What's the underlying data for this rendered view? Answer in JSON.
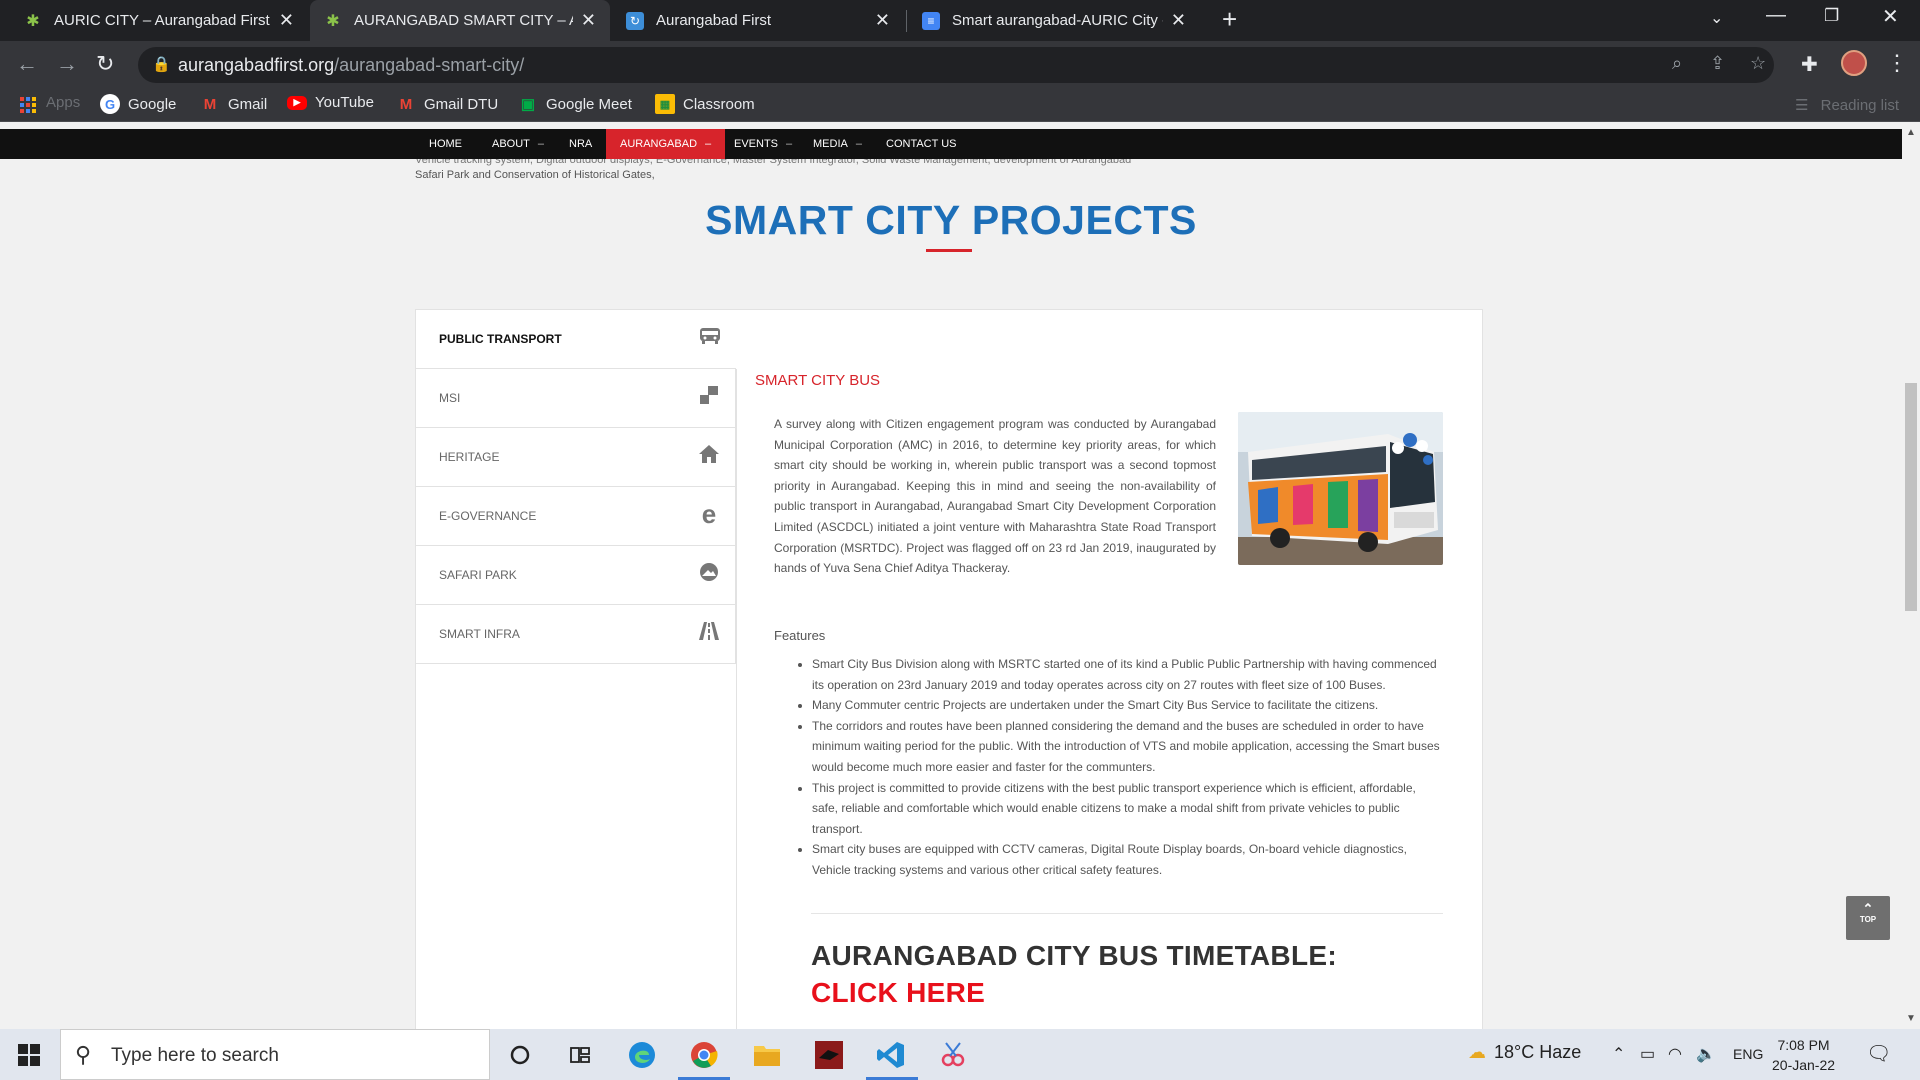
{
  "browser": {
    "tabs": [
      {
        "title": "AURIC CITY – Aurangabad First",
        "active": false
      },
      {
        "title": "AURANGABAD SMART CITY – Au",
        "active": true
      },
      {
        "title": "Aurangabad First",
        "active": false
      },
      {
        "title": "Smart aurangabad-AURIC City - C",
        "active": false
      }
    ],
    "url_domain": "aurangabadfirst.org",
    "url_path": "/aurangabad-smart-city/",
    "bookmarks": [
      {
        "label": "Apps",
        "icon": "apps-icon"
      },
      {
        "label": "Google",
        "icon": "google-icon"
      },
      {
        "label": "Gmail",
        "icon": "gmail-icon"
      },
      {
        "label": "YouTube",
        "icon": "youtube-icon"
      },
      {
        "label": "Gmail DTU",
        "icon": "gmail-icon"
      },
      {
        "label": "Google Meet",
        "icon": "meet-icon"
      },
      {
        "label": "Classroom",
        "icon": "classroom-icon"
      }
    ],
    "reading_list": "Reading list"
  },
  "site": {
    "nav": [
      {
        "label": "HOME",
        "dropdown": false
      },
      {
        "label": "ABOUT",
        "dropdown": true
      },
      {
        "label": "NRA",
        "dropdown": false
      },
      {
        "label": "AURANGABAD",
        "dropdown": true,
        "active": true
      },
      {
        "label": "EVENTS",
        "dropdown": true
      },
      {
        "label": "MEDIA",
        "dropdown": true
      },
      {
        "label": "CONTACT US",
        "dropdown": false
      }
    ],
    "ghost_text": "ASCDCL has started the operation of Smart City Bus Service, which is the flagship project of City Bus Service and upcoming key projects of upgrading the Public Transport by introducing Bus Shelters, E-Ticketing, Vehicle tracking system, Digital outdoor displays, E-Governance, Master System Integrator, Solid Waste Management, development of Aurangabad",
    "ghost_tail": "Safari Park and Conservation of Historical Gates,",
    "section_title": "SMART CITY PROJECTS",
    "sidemenu": [
      {
        "label": "PUBLIC TRANSPORT",
        "icon": "bus-icon",
        "active": true
      },
      {
        "label": "MSI",
        "icon": "blocks-icon"
      },
      {
        "label": "HERITAGE",
        "icon": "home-icon"
      },
      {
        "label": "E-GOVERNANCE",
        "icon": "e-icon"
      },
      {
        "label": "SAFARI PARK",
        "icon": "park-icon"
      },
      {
        "label": "SMART INFRA",
        "icon": "road-icon"
      }
    ],
    "content": {
      "title": "SMART CITY BUS",
      "paragraph": "A survey along with Citizen engagement program was conducted by Aurangabad Municipal Corporation (AMC) in 2016, to determine key priority areas, for which smart city should be working in, wherein public transport was a second topmost priority in Aurangabad. Keeping this in mind and seeing the non-availability of public transport in Aurangabad, Aurangabad Smart City Development Corporation Limited (ASCDCL) initiated a joint venture with Maharashtra State Road Transport Corporation (MSRTDC). Project was flagged off on 23 rd Jan 2019, inaugurated by hands of Yuva Sena Chief Aditya Thackeray.",
      "features_heading": "Features",
      "features": [
        "Smart City Bus Division along with MSRTC started one of its kind a Public Public Partnership with having commenced its operation on 23rd January 2019 and today operates across city on 27 routes with fleet size of 100 Buses.",
        "Many Commuter centric Projects are undertaken under the Smart City Bus Service to facilitate the citizens.",
        "The corridors and routes have been planned considering the demand and the buses are scheduled in order to have minimum waiting period for the public. With the introduction of VTS and mobile application, accessing the Smart buses would become much more easier and faster for the communters.",
        "This project is committed to provide citizens with the best public transport experience which is efficient, affordable, safe, reliable and comfortable which would enable citizens to make a modal shift from private vehicles to public transport.",
        "Smart city buses are equipped with CCTV cameras, Digital Route Display boards, On-board vehicle diagnostics, Vehicle tracking systems and various other critical safety features."
      ],
      "timetable_heading": "AURANGABAD CITY BUS TIMETABLE:",
      "timetable_link": "CLICK HERE"
    },
    "top_button": "TOP"
  },
  "taskbar": {
    "search_placeholder": "Type here to search",
    "weather": "18°C  Haze",
    "language": "ENG",
    "time": "7:08 PM",
    "date": "20-Jan-22"
  },
  "colors": {
    "accent_red": "#d7242b",
    "title_blue": "#1d6fb8",
    "link_red": "#e8101b"
  }
}
